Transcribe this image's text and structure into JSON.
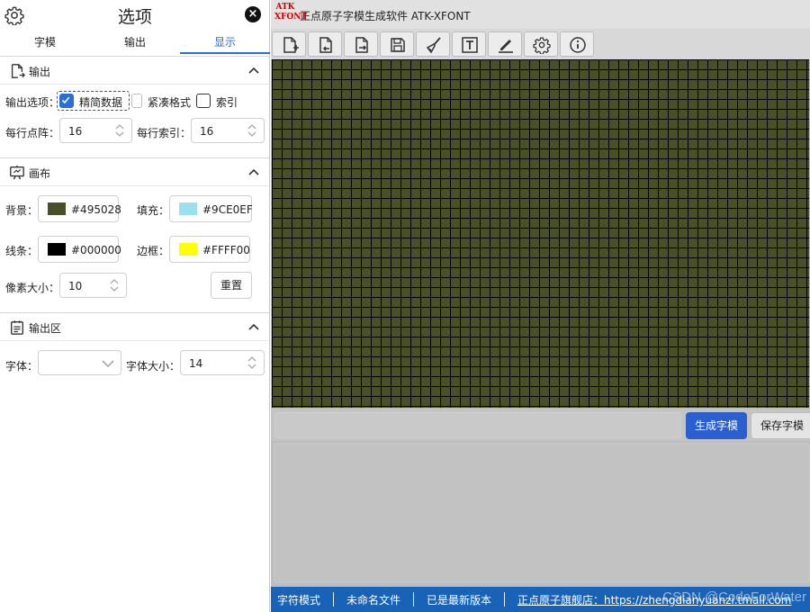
{
  "panel": {
    "title": "选项",
    "tabs": [
      {
        "label": "字模",
        "active": false
      },
      {
        "label": "输出",
        "active": false
      },
      {
        "label": "显示",
        "active": true
      }
    ],
    "output_section": {
      "title": "输出",
      "options_label": "输出选项：",
      "checkboxes": [
        {
          "label": "精简数据",
          "checked": true
        },
        {
          "label": "紧凑格式",
          "checked": false
        },
        {
          "label": "索引",
          "checked": false
        }
      ],
      "dots_per_row_label": "每行点阵：",
      "dots_per_row_value": "16",
      "index_per_row_label": "每行索引：",
      "index_per_row_value": "16"
    },
    "canvas_section": {
      "title": "画布",
      "background_label": "背景：",
      "background_hex": "#495028",
      "fill_label": "填充：",
      "fill_hex": "#9CE0EF",
      "line_label": "线条：",
      "line_hex": "#000000",
      "border_label": "边框：",
      "border_hex": "#FFFF00",
      "pixel_size_label": "像素大小：",
      "pixel_size_value": "10",
      "reset_label": "重置"
    },
    "output_area_section": {
      "title": "输出区",
      "font_label": "字体：",
      "font_value": "",
      "font_size_label": "字体大小：",
      "font_size_value": "14"
    }
  },
  "app": {
    "logo_text": "ATK XFONT",
    "title": "正点原子字模生成软件 ATK-XFONT",
    "toolbar_icons": [
      "new-file-icon",
      "open-file-icon",
      "export-file-icon",
      "save-icon",
      "brush-icon",
      "text-icon",
      "pen-icon",
      "settings-icon",
      "info-icon"
    ],
    "canvas": {
      "background": "#495028",
      "grid_line": "#000000"
    },
    "generate_label": "生成字模",
    "save_label": "保存字模",
    "status": {
      "mode": "字符模式",
      "file": "未命名文件",
      "version": "已是最新版本",
      "store_link": "正点原子旗舰店：https://zhengdianyuanzi.tmall.com",
      "watermark": "CSDN @CodeForWater"
    }
  }
}
